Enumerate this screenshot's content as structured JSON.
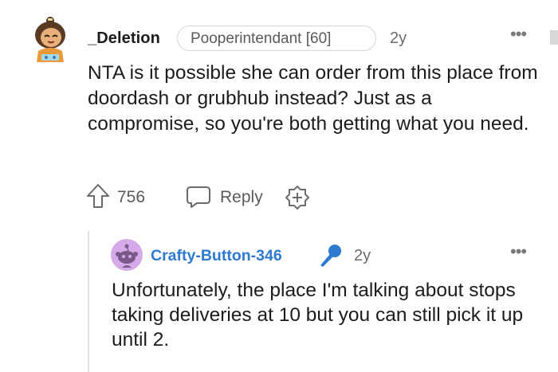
{
  "comment": {
    "username": "_Deletion",
    "flair": "Pooperintendant [60]",
    "age": "2y",
    "more": "•••",
    "body": "NTA is it possible she can order from this place from doordash or grubhub instead? Just as a compromise, so you're both getting what you need.",
    "score": "756",
    "reply_label": "Reply"
  },
  "reply": {
    "username": "Crafty-Button-346",
    "age": "2y",
    "more": "•••",
    "body": "Unfortunately, the place I'm talking about stops taking deliveries at 10 but you can still pick it up until 2."
  },
  "colors": {
    "username_link": "#2e7ad1",
    "mic_icon": "#2e7ad1",
    "muted_text": "#5a5a5a"
  },
  "icons": {
    "avatar1": "snoo-avatar-icon",
    "upvote": "upvote-arrow-icon",
    "reply": "speech-bubble-icon",
    "award": "add-award-icon",
    "avatar2": "default-snoo-avatar-icon",
    "mic": "microphone-icon",
    "more": "more-options-icon"
  }
}
